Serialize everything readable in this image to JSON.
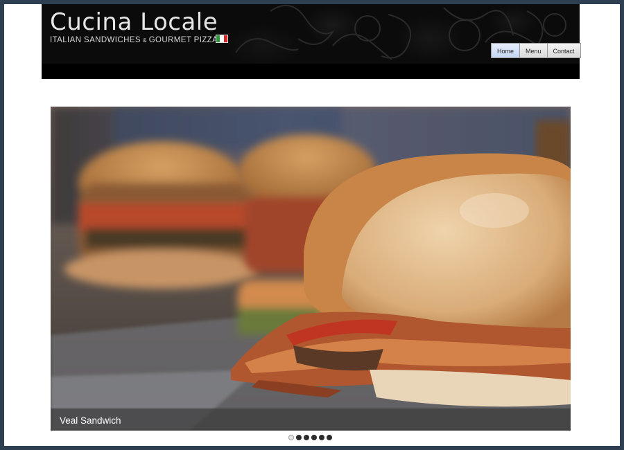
{
  "header": {
    "title": "Cucina Locale",
    "tagline_left": "ITALIAN SANDWICHES",
    "tagline_amp": "&",
    "tagline_right": "GOURMET PIZZAS",
    "flag_colors": [
      "#2c9a3a",
      "#ffffff",
      "#d62828"
    ]
  },
  "nav": {
    "items": [
      {
        "label": "Home",
        "active": true
      },
      {
        "label": "Menu",
        "active": false
      },
      {
        "label": "Contact",
        "active": false
      }
    ]
  },
  "slider": {
    "caption": "Veal Sandwich",
    "slide_count": 6,
    "active_slide": 1
  },
  "colors": {
    "frame": "#2e3f52",
    "header_bg": "#0b0b0b",
    "nav_active": "#c4d5f3"
  }
}
